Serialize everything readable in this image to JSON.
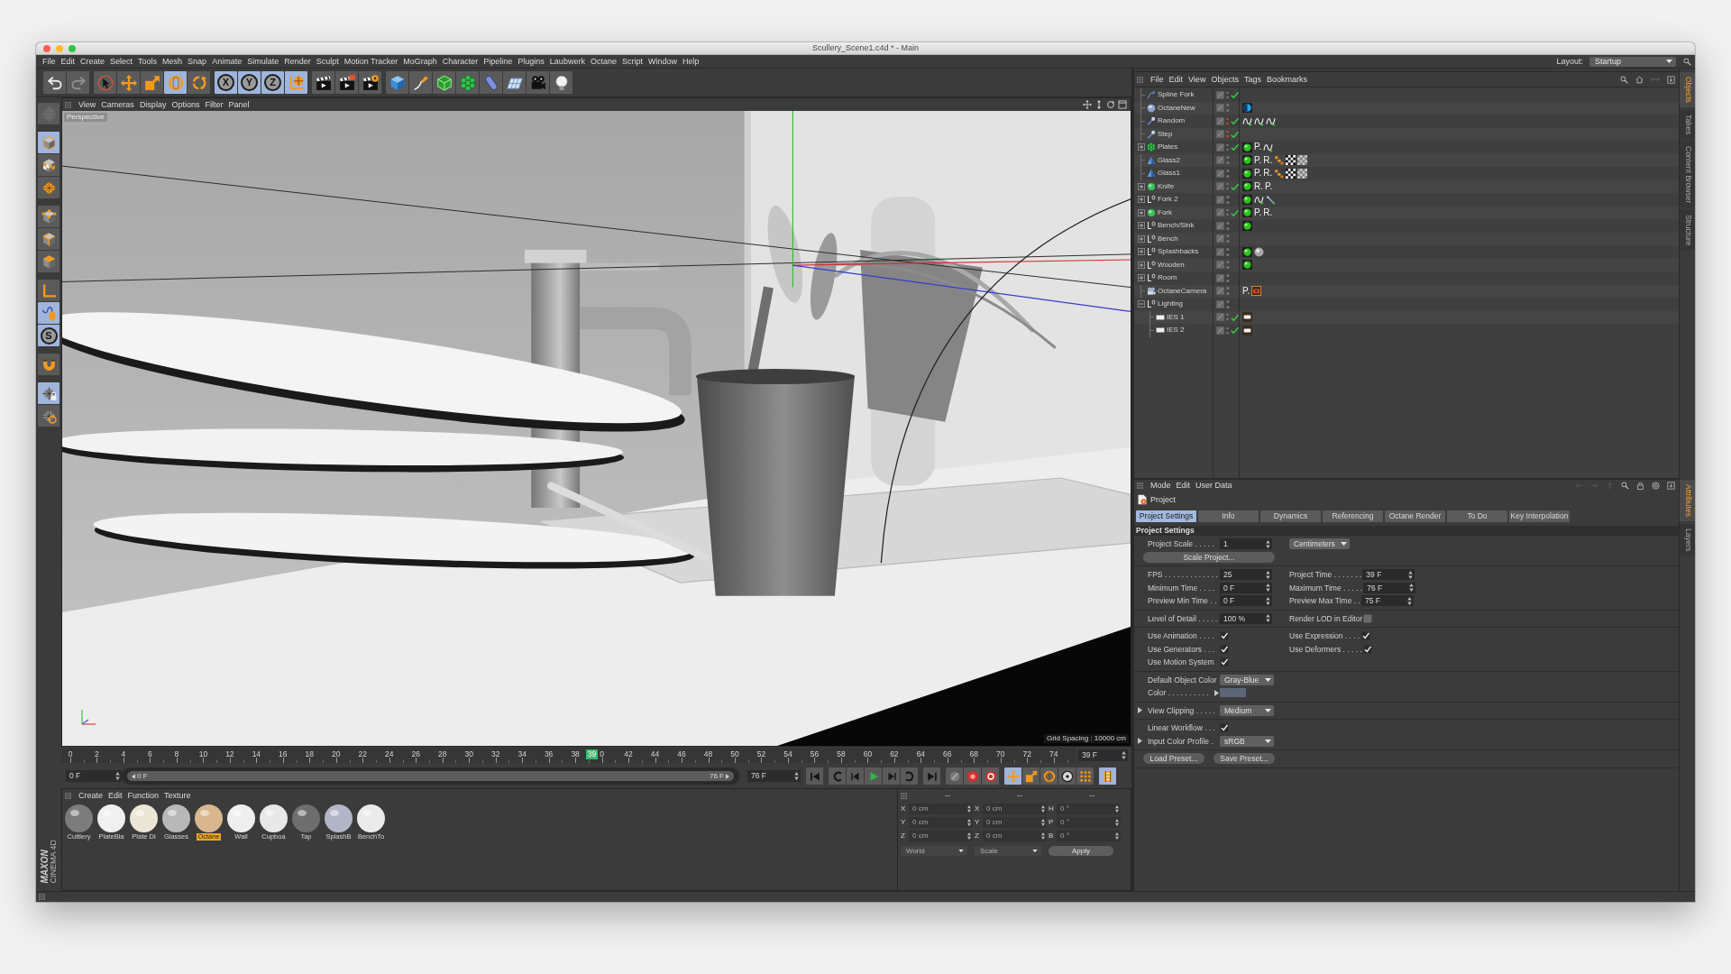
{
  "window": {
    "title": "Scullery_Scene1.c4d * - Main"
  },
  "menu_bar": {
    "items": [
      "File",
      "Edit",
      "Create",
      "Select",
      "Tools",
      "Mesh",
      "Snap",
      "Animate",
      "Simulate",
      "Render",
      "Sculpt",
      "Motion Tracker",
      "MoGraph",
      "Character",
      "Pipeline",
      "Plugins",
      "Laubwerk",
      "Octane",
      "Script",
      "Window",
      "Help"
    ],
    "layout_label": "Layout:",
    "layout_value": "Startup"
  },
  "toolbar": {
    "groups": [
      {
        "items": [
          {
            "kind": "undo",
            "selected": false,
            "disabled": false
          },
          {
            "kind": "redo",
            "selected": false,
            "disabled": true
          }
        ]
      },
      {
        "items": [
          {
            "kind": "select",
            "selected": false,
            "disabled": false
          },
          {
            "kind": "move",
            "selected": false,
            "disabled": false
          },
          {
            "kind": "scale",
            "selected": false,
            "disabled": false
          },
          {
            "kind": "rotate",
            "selected": true,
            "disabled": false
          },
          {
            "kind": "recent",
            "selected": false,
            "disabled": false
          }
        ]
      },
      {
        "items": [
          {
            "kind": "axis",
            "text": "X",
            "selected": true,
            "disabled": false
          },
          {
            "kind": "axis",
            "text": "Y",
            "selected": true,
            "disabled": false
          },
          {
            "kind": "axis",
            "text": "Z",
            "selected": true,
            "disabled": false
          },
          {
            "kind": "coords",
            "selected": true,
            "disabled": false
          }
        ]
      },
      {
        "items": [
          {
            "kind": "render_view",
            "selected": false,
            "disabled": false
          },
          {
            "kind": "render_picture",
            "selected": false,
            "disabled": false
          },
          {
            "kind": "render_settings",
            "selected": false,
            "disabled": false
          }
        ]
      },
      {
        "items": [
          {
            "kind": "cube",
            "selected": false,
            "disabled": false
          },
          {
            "kind": "pen",
            "selected": false,
            "disabled": false
          },
          {
            "kind": "subdivide",
            "selected": false,
            "disabled": false
          },
          {
            "kind": "cloner",
            "selected": false,
            "disabled": false
          },
          {
            "kind": "deformer",
            "selected": false,
            "disabled": false
          },
          {
            "kind": "floor",
            "selected": false,
            "disabled": false
          },
          {
            "kind": "camera",
            "selected": false,
            "disabled": false
          },
          {
            "kind": "light",
            "selected": false,
            "disabled": false
          }
        ]
      }
    ]
  },
  "left_toolbar": {
    "groups": [
      {
        "items": [
          {
            "kind": "make_editable",
            "selected": false,
            "disabled": true
          }
        ]
      },
      {
        "items": [
          {
            "kind": "model",
            "selected": true,
            "disabled": false
          },
          {
            "kind": "texture",
            "selected": false,
            "disabled": false
          },
          {
            "kind": "workplane",
            "selected": false,
            "disabled": false
          }
        ]
      },
      {
        "items": [
          {
            "kind": "points",
            "selected": false,
            "disabled": false
          },
          {
            "kind": "edges",
            "selected": false,
            "disabled": false
          },
          {
            "kind": "polygons",
            "selected": false,
            "disabled": false
          }
        ]
      },
      {
        "items": [
          {
            "kind": "axis",
            "selected": false,
            "disabled": false
          },
          {
            "kind": "tweak",
            "selected": true,
            "disabled": false
          },
          {
            "kind": "solo",
            "text": "S",
            "selected": true,
            "disabled": false
          }
        ]
      },
      {
        "items": [
          {
            "kind": "snap",
            "selected": false,
            "disabled": false
          }
        ]
      },
      {
        "items": [
          {
            "kind": "lock_workplane",
            "selected": true,
            "disabled": false
          },
          {
            "kind": "planar_workplane",
            "selected": false,
            "disabled": false
          }
        ]
      }
    ]
  },
  "viewport": {
    "menu": [
      "View",
      "Cameras",
      "Display",
      "Options",
      "Filter",
      "Panel"
    ],
    "camera": "Perspective",
    "grid_spacing": "Grid Spacing : 10000 cm"
  },
  "timeline": {
    "ticks": [
      "0",
      "2",
      "4",
      "6",
      "8",
      "10",
      "12",
      "14",
      "16",
      "18",
      "20",
      "22",
      "24",
      "26",
      "28",
      "30",
      "32",
      "34",
      "36",
      "38",
      "0",
      "42",
      "44",
      "46",
      "48",
      "50",
      "52",
      "54",
      "56",
      "58",
      "60",
      "62",
      "64",
      "66",
      "68",
      "70",
      "72",
      "74"
    ],
    "playhead": {
      "label": "39",
      "level": 0.513
    },
    "current_field": "39 F",
    "start_field": "0 F",
    "preview_range": {
      "start": "0 F",
      "end": "76 F",
      "level": 1
    },
    "end_field": "76 F",
    "key_tools": [
      {
        "kind": "position",
        "selected": true
      },
      {
        "kind": "scale",
        "selected": false
      },
      {
        "kind": "rotation",
        "selected": false
      },
      {
        "kind": "parameter",
        "selected": false
      },
      {
        "kind": "points",
        "selected": false
      }
    ],
    "timeline_toggle": {
      "selected": true
    }
  },
  "materials": {
    "menu": [
      "Create",
      "Edit",
      "Function",
      "Texture"
    ],
    "items": [
      {
        "name": "Cuttlery",
        "color": "#7c7c7c",
        "selected": false
      },
      {
        "name": "PlateBla",
        "color": "#f0f0f0",
        "selected": false
      },
      {
        "name": "Plate Di",
        "color": "#ece6d6",
        "selected": false
      },
      {
        "name": "Glasses",
        "color": "#b8b8b8",
        "selected": false
      },
      {
        "name": "Octane",
        "color": "#d9b68e",
        "selected": true
      },
      {
        "name": "Wall",
        "color": "#eeeeee",
        "selected": false
      },
      {
        "name": "Cupboa",
        "color": "#e8e8e8",
        "selected": false
      },
      {
        "name": "Tap",
        "color": "#6e6e6e",
        "selected": false
      },
      {
        "name": "SplashB",
        "color": "#b2b5c8",
        "selected": false
      },
      {
        "name": "BenchTo",
        "color": "#ebebeb",
        "selected": false
      }
    ]
  },
  "coordinates": {
    "headers": [
      "--",
      "--",
      "--"
    ],
    "rows": [
      {
        "cells": [
          {
            "axis": "X",
            "value": "0 cm"
          },
          {
            "axis": "X",
            "value": "0 cm"
          },
          {
            "axis": "H",
            "value": "0 °"
          }
        ]
      },
      {
        "cells": [
          {
            "axis": "Y",
            "value": "0 cm"
          },
          {
            "axis": "Y",
            "value": "0 cm"
          },
          {
            "axis": "P",
            "value": "0 °"
          }
        ]
      },
      {
        "cells": [
          {
            "axis": "Z",
            "value": "0 cm"
          },
          {
            "axis": "Z",
            "value": "0 cm"
          },
          {
            "axis": "B",
            "value": "0 °"
          }
        ]
      }
    ],
    "modes": [
      "World",
      "Scale"
    ],
    "apply": "Apply",
    "disabled": true
  },
  "logo": {
    "brand": "MAXON",
    "product": "CINEMA 4D"
  },
  "object_manager": {
    "menu": [
      "File",
      "Edit",
      "View",
      "Objects",
      "Tags",
      "Bookmarks"
    ],
    "objects": [
      {
        "name": "Spline Fork",
        "kind": "spline",
        "visible": true,
        "checked": true,
        "selected": false
      },
      {
        "name": "OctaneNew",
        "kind": "sky",
        "visible": true,
        "checked": false,
        "selected": false,
        "tags": [
          {
            "kind": "environment"
          }
        ]
      },
      {
        "name": "Random",
        "kind": "effector",
        "visible": false,
        "checked": true,
        "selected": false,
        "tags": [
          {
            "kind": "curve"
          },
          {
            "kind": "curve"
          },
          {
            "kind": "curve"
          }
        ]
      },
      {
        "name": "Step",
        "kind": "effector",
        "visible": false,
        "checked": true,
        "selected": false
      },
      {
        "name": "Plates",
        "kind": "cloner",
        "expanded": false,
        "visible": true,
        "checked": true,
        "selected": false,
        "tags": [
          {
            "kind": "material"
          },
          {
            "kind": "letter",
            "text": "P."
          },
          {
            "kind": "curve"
          }
        ]
      },
      {
        "name": "Glass2",
        "kind": "lathe",
        "visible": true,
        "checked": false,
        "selected": false,
        "tags": [
          {
            "kind": "material"
          },
          {
            "kind": "letter",
            "text": "P."
          },
          {
            "kind": "letter",
            "text": "R."
          },
          {
            "kind": "dots"
          },
          {
            "kind": "checker"
          },
          {
            "kind": "checker_gray"
          }
        ]
      },
      {
        "name": "Glass1",
        "kind": "lathe",
        "visible": true,
        "checked": false,
        "selected": false,
        "tags": [
          {
            "kind": "material"
          },
          {
            "kind": "letter",
            "text": "P."
          },
          {
            "kind": "letter",
            "text": "R."
          },
          {
            "kind": "dots"
          },
          {
            "kind": "checker"
          },
          {
            "kind": "checker_gray"
          }
        ]
      },
      {
        "name": "Knife",
        "kind": "sphere",
        "expanded": false,
        "visible": true,
        "checked": true,
        "selected": false,
        "tags": [
          {
            "kind": "material"
          },
          {
            "kind": "letter",
            "text": "R."
          },
          {
            "kind": "letter",
            "text": "P."
          }
        ]
      },
      {
        "name": "Fork 2",
        "kind": "null_object",
        "expanded": false,
        "visible": true,
        "checked": false,
        "selected": false,
        "tags": [
          {
            "kind": "material"
          },
          {
            "kind": "curve"
          },
          {
            "kind": "pen"
          }
        ]
      },
      {
        "name": "Fork",
        "kind": "sphere",
        "expanded": false,
        "visible": true,
        "checked": true,
        "selected": false,
        "tags": [
          {
            "kind": "material"
          },
          {
            "kind": "letter",
            "text": "P."
          },
          {
            "kind": "letter",
            "text": "R."
          }
        ]
      },
      {
        "name": "Bench/Sink",
        "kind": "null_object",
        "expanded": false,
        "visible": true,
        "checked": false,
        "selected": false,
        "tags": [
          {
            "kind": "material"
          }
        ]
      },
      {
        "name": "Bench",
        "kind": "null_object",
        "expanded": false,
        "visible": true,
        "checked": false,
        "selected": false
      },
      {
        "name": "Splashbacks",
        "kind": "null_object",
        "expanded": false,
        "visible": true,
        "checked": false,
        "selected": false,
        "tags": [
          {
            "kind": "material"
          },
          {
            "kind": "sphere"
          }
        ]
      },
      {
        "name": "Wooden",
        "kind": "null_object",
        "expanded": false,
        "visible": true,
        "checked": false,
        "selected": false,
        "tags": [
          {
            "kind": "material"
          }
        ]
      },
      {
        "name": "Room",
        "kind": "null_object",
        "expanded": false,
        "visible": true,
        "checked": false,
        "selected": false
      },
      {
        "name": "OctaneCamera",
        "kind": "camera",
        "visible": true,
        "checked": false,
        "selected": false,
        "tags": [
          {
            "kind": "letter",
            "text": "P."
          },
          {
            "kind": "camera_tag"
          }
        ]
      },
      {
        "name": "Lighting",
        "kind": "null_object",
        "expanded": true,
        "visible": true,
        "checked": false,
        "selected": false,
        "children": [
          {
            "name": "IES 1",
            "kind": "area_light",
            "visible": true,
            "checked": true,
            "selected": false,
            "tags": [
              {
                "kind": "light_tag"
              }
            ]
          },
          {
            "name": "IES 2",
            "kind": "area_light",
            "visible": true,
            "checked": true,
            "selected": false,
            "tags": [
              {
                "kind": "light_tag"
              }
            ]
          }
        ]
      }
    ]
  },
  "side_tabs": {
    "upper": [
      {
        "label": "Objects",
        "selected": true
      },
      {
        "label": "Takes",
        "selected": false
      },
      {
        "label": "Content Browser",
        "selected": false
      },
      {
        "label": "Structure",
        "selected": false
      }
    ],
    "lower": [
      {
        "label": "Attributes",
        "selected": true
      },
      {
        "label": "Layers",
        "selected": false
      }
    ]
  },
  "attributes": {
    "menu": [
      "Mode",
      "Edit",
      "User Data"
    ],
    "title": "Project",
    "tabs": [
      {
        "label": "Project Settings",
        "selected": true
      },
      {
        "label": "Info",
        "selected": false
      },
      {
        "label": "Dynamics",
        "selected": false
      },
      {
        "label": "Referencing",
        "selected": false
      },
      {
        "label": "Octane Render",
        "selected": false
      },
      {
        "label": "To Do",
        "selected": false
      },
      {
        "label": "Key Interpolation",
        "selected": false
      }
    ],
    "section": "Project Settings",
    "groups": [
      {
        "rows": [
          {
            "cells": [
              {
                "kind": "number",
                "label": "Project Scale . . . . .",
                "value": "1"
              },
              {
                "kind": "dropdown",
                "value": "Centimeters"
              }
            ]
          },
          {
            "cells": [
              {
                "kind": "button",
                "label": "Scale Project..."
              }
            ]
          }
        ]
      },
      {
        "rows": [
          {
            "cells": [
              {
                "kind": "number",
                "label": "FPS . . . . . . . . . . . . .",
                "value": "25"
              },
              {
                "kind": "number",
                "label": "Project Time . . . . . . .",
                "value": "39 F"
              }
            ]
          },
          {
            "cells": [
              {
                "kind": "number",
                "label": "Minimum Time . . . .",
                "value": "0 F"
              },
              {
                "kind": "number",
                "label": "Maximum Time . . . . .",
                "value": "76 F"
              }
            ]
          },
          {
            "cells": [
              {
                "kind": "number",
                "label": "Preview Min Time . .",
                "value": "0 F"
              },
              {
                "kind": "number",
                "label": "Preview Max Time . .",
                "value": "75 F"
              }
            ]
          }
        ]
      },
      {
        "rows": [
          {
            "cells": [
              {
                "kind": "number",
                "label": "Level of Detail . . . . .",
                "value": "100 %"
              },
              {
                "kind": "checkbox",
                "label": "Render LOD in Editor",
                "checked": false
              }
            ]
          }
        ]
      },
      {
        "rows": [
          {
            "cells": [
              {
                "kind": "checkbox",
                "label": "Use Animation . . . .",
                "checked": true
              },
              {
                "kind": "checkbox",
                "label": "Use Expression . . . .",
                "checked": true
              }
            ]
          },
          {
            "cells": [
              {
                "kind": "checkbox",
                "label": "Use Generators . . .",
                "checked": true
              },
              {
                "kind": "checkbox",
                "label": "Use Deformers . . . . .",
                "checked": true
              }
            ]
          },
          {
            "cells": [
              {
                "kind": "checkbox",
                "label": "Use Motion System",
                "checked": true
              }
            ]
          }
        ]
      },
      {
        "rows": [
          {
            "cells": [
              {
                "kind": "dropdown",
                "label": "Default Object Color",
                "value": "Gray-Blue"
              }
            ]
          },
          {
            "cells": [
              {
                "kind": "swatch",
                "label": "Color . . . . . . . . . .",
                "color": "#5b6676",
                "expanded": false
              }
            ]
          }
        ]
      },
      {
        "rows": [
          {
            "cells": [
              {
                "kind": "dropdown",
                "label": "View Clipping . . . . .",
                "value": "Medium",
                "expanded": false
              }
            ]
          }
        ]
      },
      {
        "rows": [
          {
            "cells": [
              {
                "kind": "checkbox",
                "label": "Linear Workflow . . .",
                "checked": true
              }
            ]
          },
          {
            "cells": [
              {
                "kind": "dropdown",
                "label": "Input Color Profile .",
                "value": "sRGB",
                "expanded": false
              }
            ]
          }
        ]
      },
      {
        "rows": [
          {
            "cells": [
              {
                "kind": "button",
                "label": "Load Preset..."
              },
              {
                "kind": "button",
                "label": "Save Preset..."
              }
            ]
          }
        ]
      }
    ]
  }
}
